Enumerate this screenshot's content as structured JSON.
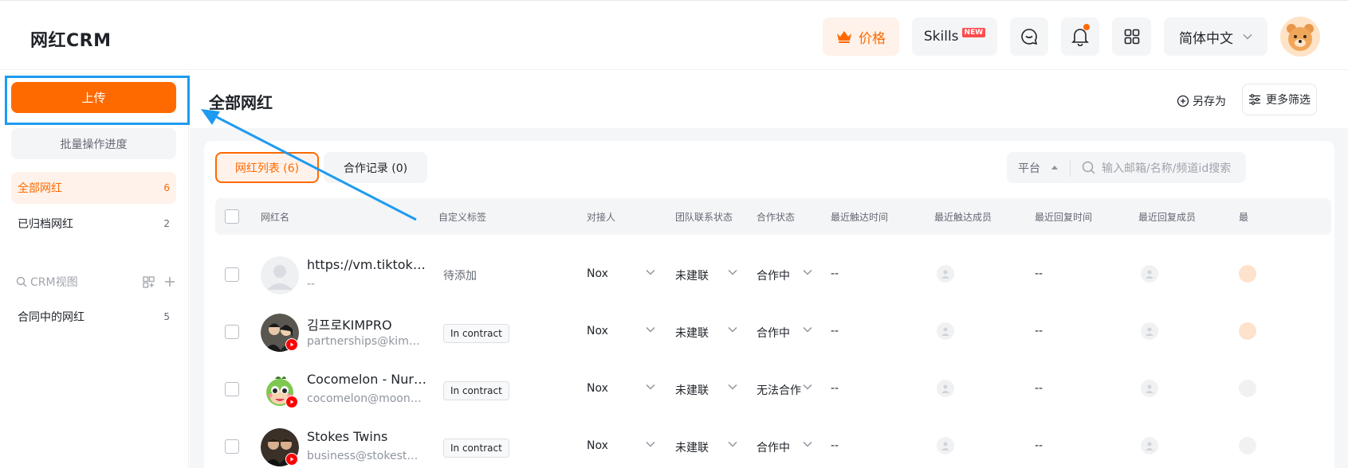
{
  "header": {
    "brand": "网红CRM",
    "price_label": "价格",
    "skills_label": "Skills",
    "skills_badge": "NEW",
    "language": "简体中文",
    "accent": "#ff6a00"
  },
  "sidebar": {
    "upload_label": "上传",
    "batch_label": "批量操作进度",
    "items": [
      {
        "label": "全部网红",
        "count": "6"
      },
      {
        "label": "已归档网红",
        "count": "2"
      }
    ],
    "crm_view_label": "CRM视图",
    "views": [
      {
        "label": "合同中的网红",
        "count": "5"
      }
    ]
  },
  "main": {
    "title": "全部网红",
    "save_as": "另存为",
    "more_filter": "更多筛选",
    "tabs": [
      {
        "label": "网红列表 (6)"
      },
      {
        "label": "合作记录 (0)"
      }
    ],
    "platform_label": "平台",
    "search_placeholder": "输入邮箱/名称/频道id搜索"
  },
  "table": {
    "columns": [
      "网红名",
      "自定义标签",
      "对接人",
      "团队联系状态",
      "合作状态",
      "最近触达时间",
      "最近触达成员",
      "最近回复时间",
      "最近回复成员",
      "最"
    ],
    "rows": [
      {
        "name": "https://vm.tiktok.com/",
        "sub": "--",
        "tag": "待添加",
        "contact": "Nox",
        "team_status": "未建联",
        "coop_status": "合作中",
        "last_reach": "--",
        "last_reply": "--"
      },
      {
        "name": "김프로KIMPRO",
        "sub": "partnerships@kimpro.com",
        "tag": "In contract",
        "contact": "Nox",
        "team_status": "未建联",
        "coop_status": "合作中",
        "last_reach": "--",
        "last_reply": "--"
      },
      {
        "name": "Cocomelon - Nursery Rhymes",
        "sub": "cocomelon@moonbug.com",
        "tag": "In contract",
        "contact": "Nox",
        "team_status": "未建联",
        "coop_status": "无法合作",
        "last_reach": "--",
        "last_reply": "--"
      },
      {
        "name": "Stokes Twins",
        "sub": "business@stokestwins.com",
        "tag": "In contract",
        "contact": "Nox",
        "team_status": "未建联",
        "coop_status": "合作中",
        "last_reach": "--",
        "last_reply": "--"
      }
    ]
  }
}
